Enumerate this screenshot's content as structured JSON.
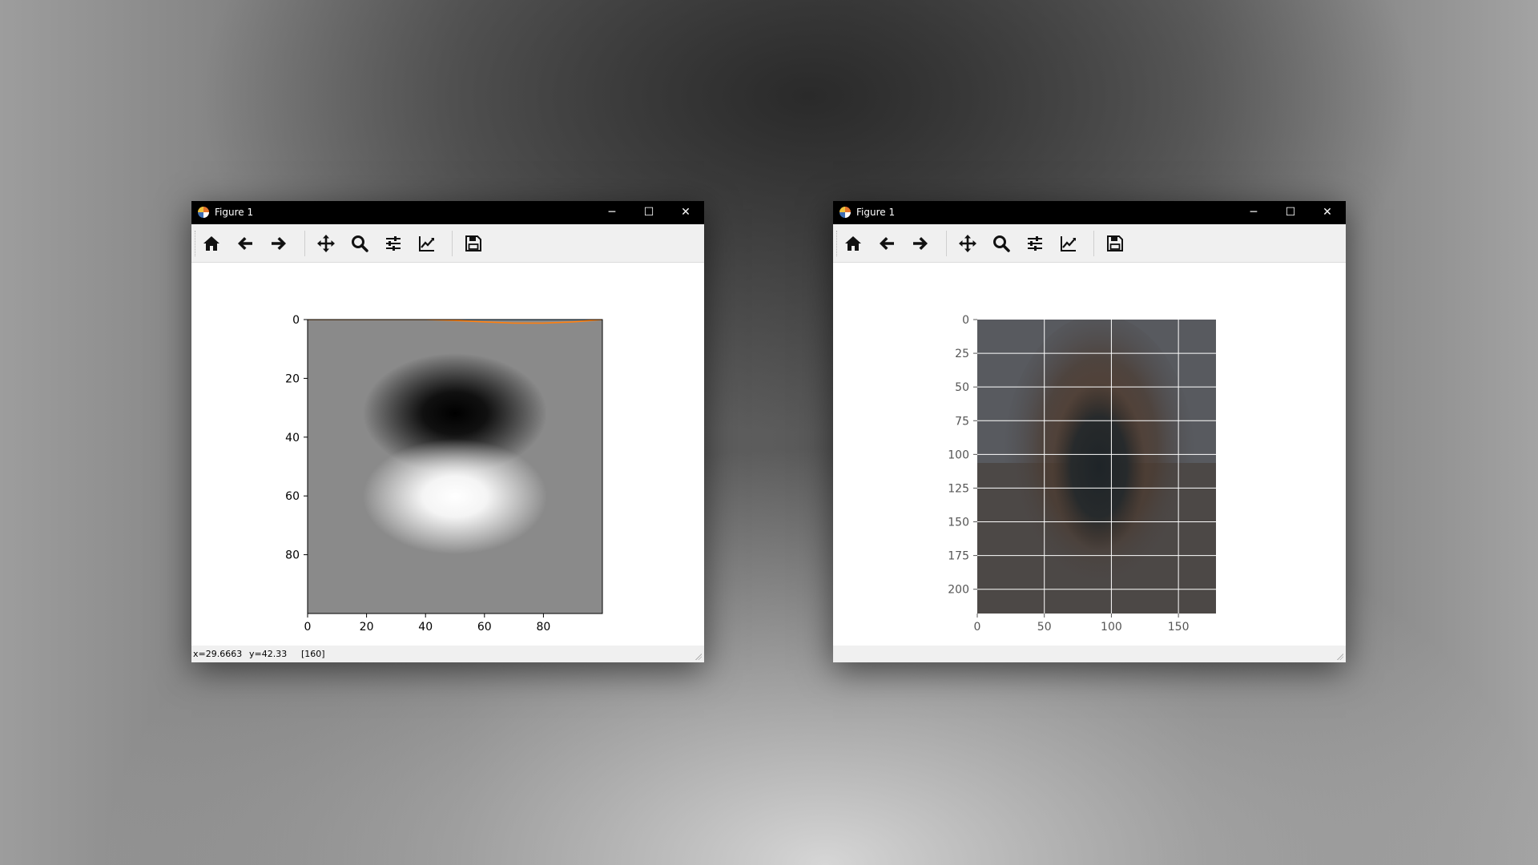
{
  "windows": [
    {
      "title": "Figure 1",
      "controls": {
        "minimize": "─",
        "maximize": "☐",
        "close": "✕"
      },
      "toolbar": [
        "home-icon",
        "back-icon",
        "forward-icon",
        "pan-icon",
        "zoom-icon",
        "configure-subplots-icon",
        "edit-axis-icon",
        "save-icon"
      ],
      "status": {
        "x": "x=29.6663",
        "y": "y=42.33",
        "value": "[160]"
      },
      "chart_data": {
        "type": "heatmap",
        "description_colormap": "gray",
        "x_ticks": [
          "0",
          "20",
          "40",
          "60",
          "80"
        ],
        "y_ticks": [
          "0",
          "20",
          "40",
          "60",
          "80"
        ],
        "xlim": [
          0,
          100
        ],
        "ylim": [
          100,
          0
        ],
        "grid": false,
        "image": {
          "dark_blob_center": [
            50,
            35
          ],
          "bright_blob_center": [
            50,
            63
          ],
          "background_level": 0.55
        },
        "series": [
          {
            "color": "#1f77b4",
            "x": [
              0,
              20,
              40,
              50,
              60,
              80,
              100
            ],
            "y": [
              0.0,
              0.0,
              0.0,
              0.0,
              0.0,
              0.0,
              0.0
            ]
          },
          {
            "color": "#ff7f0e",
            "x": [
              0,
              20,
              40,
              50,
              60,
              70,
              80,
              90,
              100
            ],
            "y": [
              0.0,
              0.0,
              0.0,
              0.3,
              0.8,
              1.2,
              1.2,
              0.8,
              0.0
            ]
          }
        ]
      }
    },
    {
      "title": "Figure 1",
      "controls": {
        "minimize": "─",
        "maximize": "☐",
        "close": "✕"
      },
      "toolbar": [
        "home-icon",
        "back-icon",
        "forward-icon",
        "pan-icon",
        "zoom-icon",
        "configure-subplots-icon",
        "edit-axis-icon",
        "save-icon"
      ],
      "status": {
        "x": "",
        "y": "",
        "value": ""
      },
      "chart_data": {
        "type": "heatmap",
        "description_colormap": "rgb photo",
        "x_ticks": [
          "0",
          "50",
          "100",
          "150"
        ],
        "y_ticks": [
          "0",
          "25",
          "50",
          "75",
          "100",
          "125",
          "150",
          "175",
          "200"
        ],
        "xlim": [
          0,
          178
        ],
        "ylim": [
          218,
          0
        ],
        "grid": true,
        "grid_x": [
          50,
          100,
          150
        ],
        "grid_y": [
          25,
          50,
          75,
          100,
          125,
          150,
          175,
          200
        ],
        "colors": {
          "background": "#595a5e",
          "figure": "#3b3532",
          "face": "#23272a"
        }
      }
    }
  ],
  "colors": {
    "titlebar": "#000000",
    "toolbar": "#f0f0f0"
  }
}
